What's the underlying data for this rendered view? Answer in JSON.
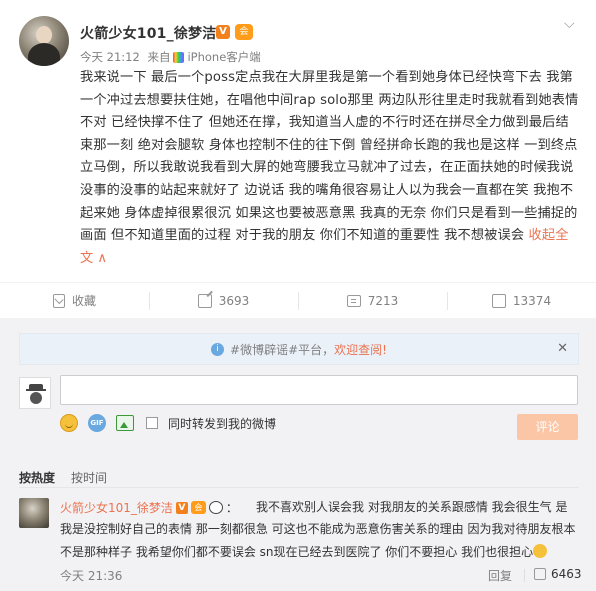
{
  "post": {
    "username": "火箭少女101_徐梦洁",
    "verified_badge": "V",
    "member_badge": "会",
    "menu_icon": "chevron-down-icon",
    "time": "今天 21:12",
    "source_prefix": "来自",
    "source_device": "iPhone客户端",
    "content": "我来说一下  最后一个poss定点我在大屏里我是第一个看到她身体已经快弯下去 我第一个冲过去想要扶住她，在唱他中间rap solo那里 两边队形往里走时我就看到她表情不对 已经快撑不住了 但她还在撑，我知道当人虚的不行时还在拼尽全力做到最后结束那一刻 绝对会腿软 身体也控制不住的往下倒 曾经拼命长跑的我也是这样 一到终点 立马倒，所以我敢说我看到大屏的她弯腰我立马就冲了过去，在正面扶她的时候我说没事的没事的站起来就好了 边说话 我的嘴角很容易让人以为我会一直都在笑 我抱不起来她 身体虚掉很累很沉 如果这也要被恶意黑 我真的无奈 你们只是看到一些捕捉的画面 但不知道里面的过程 对于我的朋友 你们不知道的重要性 我不想被误会 ",
    "collapse_label": "收起全文",
    "collapse_arrow": "∧"
  },
  "actions": {
    "favorite_label": "收藏",
    "share_count": "3693",
    "comment_count": "7213",
    "like_count": "13374"
  },
  "notice": {
    "prefix": "#微博辟谣#平台，",
    "link": "欢迎查阅!",
    "close": "✕"
  },
  "composer": {
    "input_value": "",
    "forward_label": "同时转发到我的微博",
    "submit_label": "评论"
  },
  "sort": {
    "hot": "按热度",
    "time": "按时间"
  },
  "comment": {
    "author": "火箭少女101_徐梦洁",
    "text": "我不喜欢别人误会我 对我朋友的关系跟感情 我会很生气 是 我是没控制好自己的表情 那一刻都很急 可这也不能成为恶意伤害关系的理由 因为我对待朋友根本不是那种样子 我希望你们都不要误会 sn现在已经去到医院了 你们不要担心 我们也很担心",
    "time": "今天 21:36",
    "reply_label": "回复",
    "like_count": "6463"
  },
  "colors": {
    "accent": "#eb7350",
    "background": "#f2f2f5",
    "submit_disabled": "#fbc6a6"
  }
}
